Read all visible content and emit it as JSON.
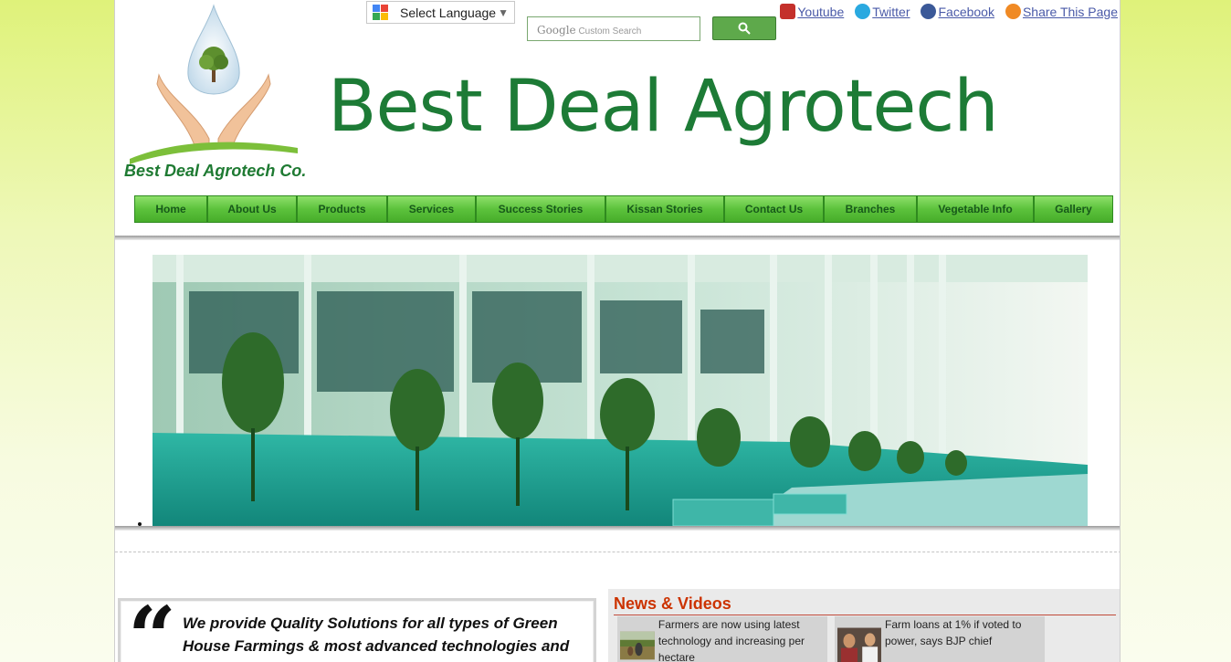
{
  "translate": {
    "label": "Select Language",
    "arrow": "▼"
  },
  "search": {
    "brand": "Google",
    "placeholder": "Custom Search"
  },
  "social": [
    {
      "label": "Youtube",
      "color": "#c4302b"
    },
    {
      "label": "Twitter",
      "color": "#2aa9e0"
    },
    {
      "label": "Facebook",
      "color": "#3b5998"
    },
    {
      "label": "Share This Page",
      "color": "#f08a24"
    }
  ],
  "logo": {
    "caption": "Best Deal Agrotech Co."
  },
  "header": {
    "title": "Best Deal Agrotech"
  },
  "nav": [
    {
      "label": "Home"
    },
    {
      "label": "About Us"
    },
    {
      "label": "Products"
    },
    {
      "label": "Services"
    },
    {
      "label": "Success Stories"
    },
    {
      "label": "Kissan Stories"
    },
    {
      "label": "Contact Us"
    },
    {
      "label": "Branches"
    },
    {
      "label": "Vegetable Info"
    },
    {
      "label": "Gallery"
    }
  ],
  "quote": {
    "mark": "“",
    "text": "We provide Quality Solutions for all types of Green House Farmings & most advanced technologies and"
  },
  "news": {
    "title": "News & Videos",
    "items": [
      {
        "text": "Farmers are now using latest technology and increasing per hectare"
      },
      {
        "text": "Farm loans at 1% if voted to power, says BJP chief"
      }
    ]
  },
  "colors": {
    "brand_green": "#1d7b36",
    "nav_green": "#5cc23c",
    "news_red": "#cc3300"
  }
}
